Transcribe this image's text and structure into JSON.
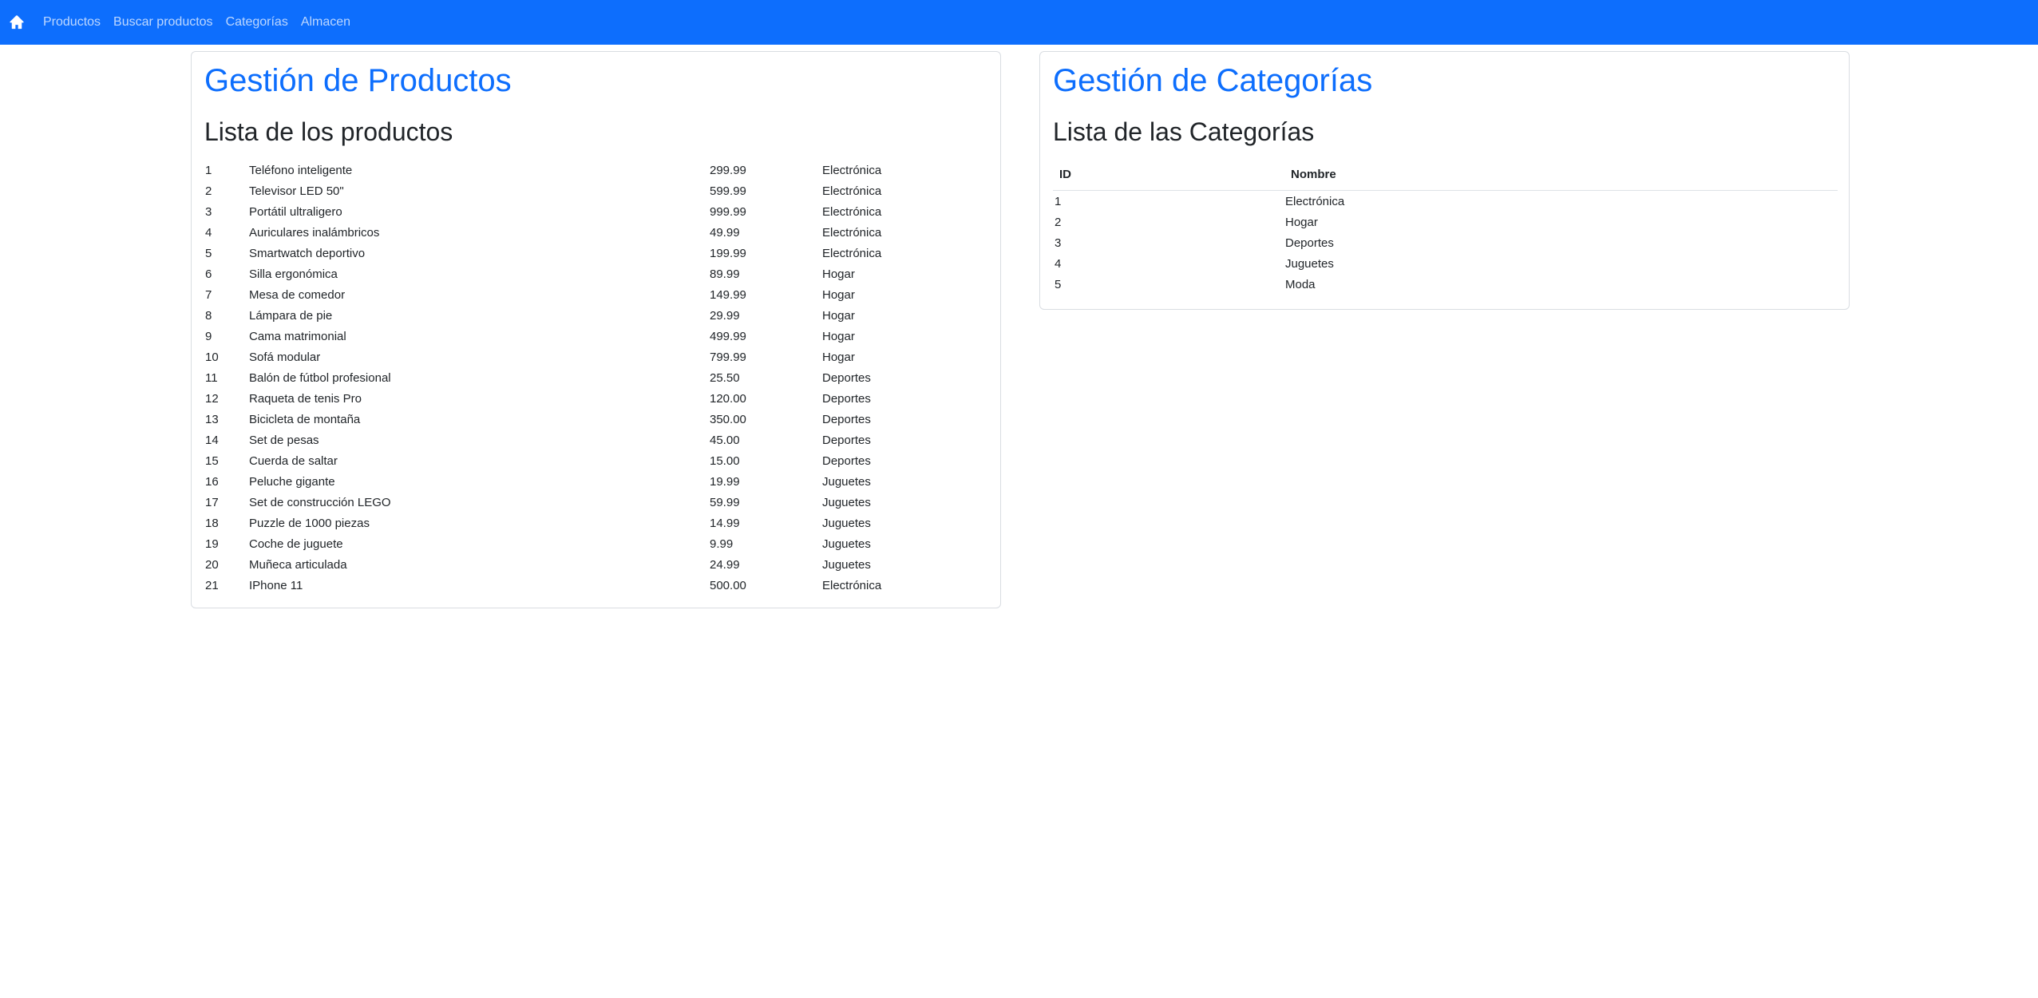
{
  "nav": {
    "home_icon": "house-icon",
    "links": [
      "Productos",
      "Buscar productos",
      "Categorías",
      "Almacen"
    ]
  },
  "colors": {
    "navbar": "#0d6efd",
    "title": "#0d6efd"
  },
  "products": {
    "title": "Gestión de Productos",
    "subtitle": "Lista de los productos",
    "rows": [
      {
        "id": "1",
        "name": "Teléfono inteligente",
        "price": "299.99",
        "category": "Electrónica"
      },
      {
        "id": "2",
        "name": "Televisor LED 50\"",
        "price": "599.99",
        "category": "Electrónica"
      },
      {
        "id": "3",
        "name": "Portátil ultraligero",
        "price": "999.99",
        "category": "Electrónica"
      },
      {
        "id": "4",
        "name": "Auriculares inalámbricos",
        "price": "49.99",
        "category": "Electrónica"
      },
      {
        "id": "5",
        "name": "Smartwatch deportivo",
        "price": "199.99",
        "category": "Electrónica"
      },
      {
        "id": "6",
        "name": "Silla ergonómica",
        "price": "89.99",
        "category": "Hogar"
      },
      {
        "id": "7",
        "name": "Mesa de comedor",
        "price": "149.99",
        "category": "Hogar"
      },
      {
        "id": "8",
        "name": "Lámpara de pie",
        "price": "29.99",
        "category": "Hogar"
      },
      {
        "id": "9",
        "name": "Cama matrimonial",
        "price": "499.99",
        "category": "Hogar"
      },
      {
        "id": "10",
        "name": "Sofá modular",
        "price": "799.99",
        "category": "Hogar"
      },
      {
        "id": "11",
        "name": "Balón de fútbol profesional",
        "price": "25.50",
        "category": "Deportes"
      },
      {
        "id": "12",
        "name": "Raqueta de tenis Pro",
        "price": "120.00",
        "category": "Deportes"
      },
      {
        "id": "13",
        "name": "Bicicleta de montaña",
        "price": "350.00",
        "category": "Deportes"
      },
      {
        "id": "14",
        "name": "Set de pesas",
        "price": "45.00",
        "category": "Deportes"
      },
      {
        "id": "15",
        "name": "Cuerda de saltar",
        "price": "15.00",
        "category": "Deportes"
      },
      {
        "id": "16",
        "name": "Peluche gigante",
        "price": "19.99",
        "category": "Juguetes"
      },
      {
        "id": "17",
        "name": "Set de construcción LEGO",
        "price": "59.99",
        "category": "Juguetes"
      },
      {
        "id": "18",
        "name": "Puzzle de 1000 piezas",
        "price": "14.99",
        "category": "Juguetes"
      },
      {
        "id": "19",
        "name": "Coche de juguete",
        "price": "9.99",
        "category": "Juguetes"
      },
      {
        "id": "20",
        "name": "Muñeca articulada",
        "price": "24.99",
        "category": "Juguetes"
      },
      {
        "id": "21",
        "name": "IPhone 11",
        "price": "500.00",
        "category": "Electrónica"
      }
    ]
  },
  "categories": {
    "title": "Gestión de Categorías",
    "subtitle": "Lista de las Categorías",
    "headers": {
      "id": "ID",
      "name": "Nombre"
    },
    "rows": [
      {
        "id": "1",
        "name": "Electrónica"
      },
      {
        "id": "2",
        "name": "Hogar"
      },
      {
        "id": "3",
        "name": "Deportes"
      },
      {
        "id": "4",
        "name": "Juguetes"
      },
      {
        "id": "5",
        "name": "Moda"
      }
    ]
  }
}
